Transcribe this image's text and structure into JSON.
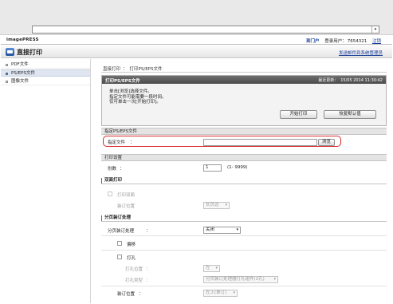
{
  "browser": {
    "address_value": ""
  },
  "header": {
    "brand": "imagePRESS",
    "portal_link": "到门户",
    "login_user_label": "登录用户：",
    "login_user_value": "7654321",
    "logout_link": "注销",
    "page_title": "直接打印",
    "mgmt_link": "发送邮件到系统管理员"
  },
  "sidebar": {
    "items": [
      {
        "label": "PDF文件",
        "active": false
      },
      {
        "label": "PS/EPS文件",
        "active": true
      },
      {
        "label": "图像文件",
        "active": false
      }
    ]
  },
  "breadcrumb": {
    "root": "直接打印",
    "separator": "：",
    "current": "打印PS/EPS文件"
  },
  "print_panel": {
    "title": "打印PS/EPS文件",
    "last_updated_label": "最近更新：",
    "last_updated_value": "15/05 2014 11:30:42",
    "instructions": [
      "单击[浏览]选择文件。",
      "指定文件可能需要一段时间。",
      "仅可单击一次[开始打印]。"
    ],
    "start_button": "开始打印",
    "restore_button": "恢复默认值"
  },
  "file_section": {
    "header": "指定PS/EPS文件",
    "label": "指定文件",
    "colon": "：",
    "value": "",
    "browse_button": "浏览"
  },
  "print_range": {
    "header": "打印设置",
    "copies_label": "份数",
    "colon": "：",
    "copies_value": "1",
    "copies_range": "(1- 9999)"
  },
  "duplex": {
    "header": "双面打印",
    "duplex_label": "打印双面",
    "binding_label": "装订位置",
    "binding_value": "长页边"
  },
  "finishing": {
    "header": "分页装订处理",
    "process_label": "分页装订处理",
    "colon": "：",
    "process_value": "关闭",
    "offset_label": "偏移",
    "punch_label": "打孔",
    "punch_position_label": "打孔位置",
    "punch_position_value": "左",
    "punch_type_label": "打孔类型",
    "punch_type_value": "分页装订处理器打孔组件(2孔)",
    "staple_label": "装订位置",
    "staple_value": "左上(单订)"
  },
  "colors": {
    "highlight": "#d42a2a",
    "link": "#1a3f9a",
    "panel_head": "#5a5a5a"
  }
}
